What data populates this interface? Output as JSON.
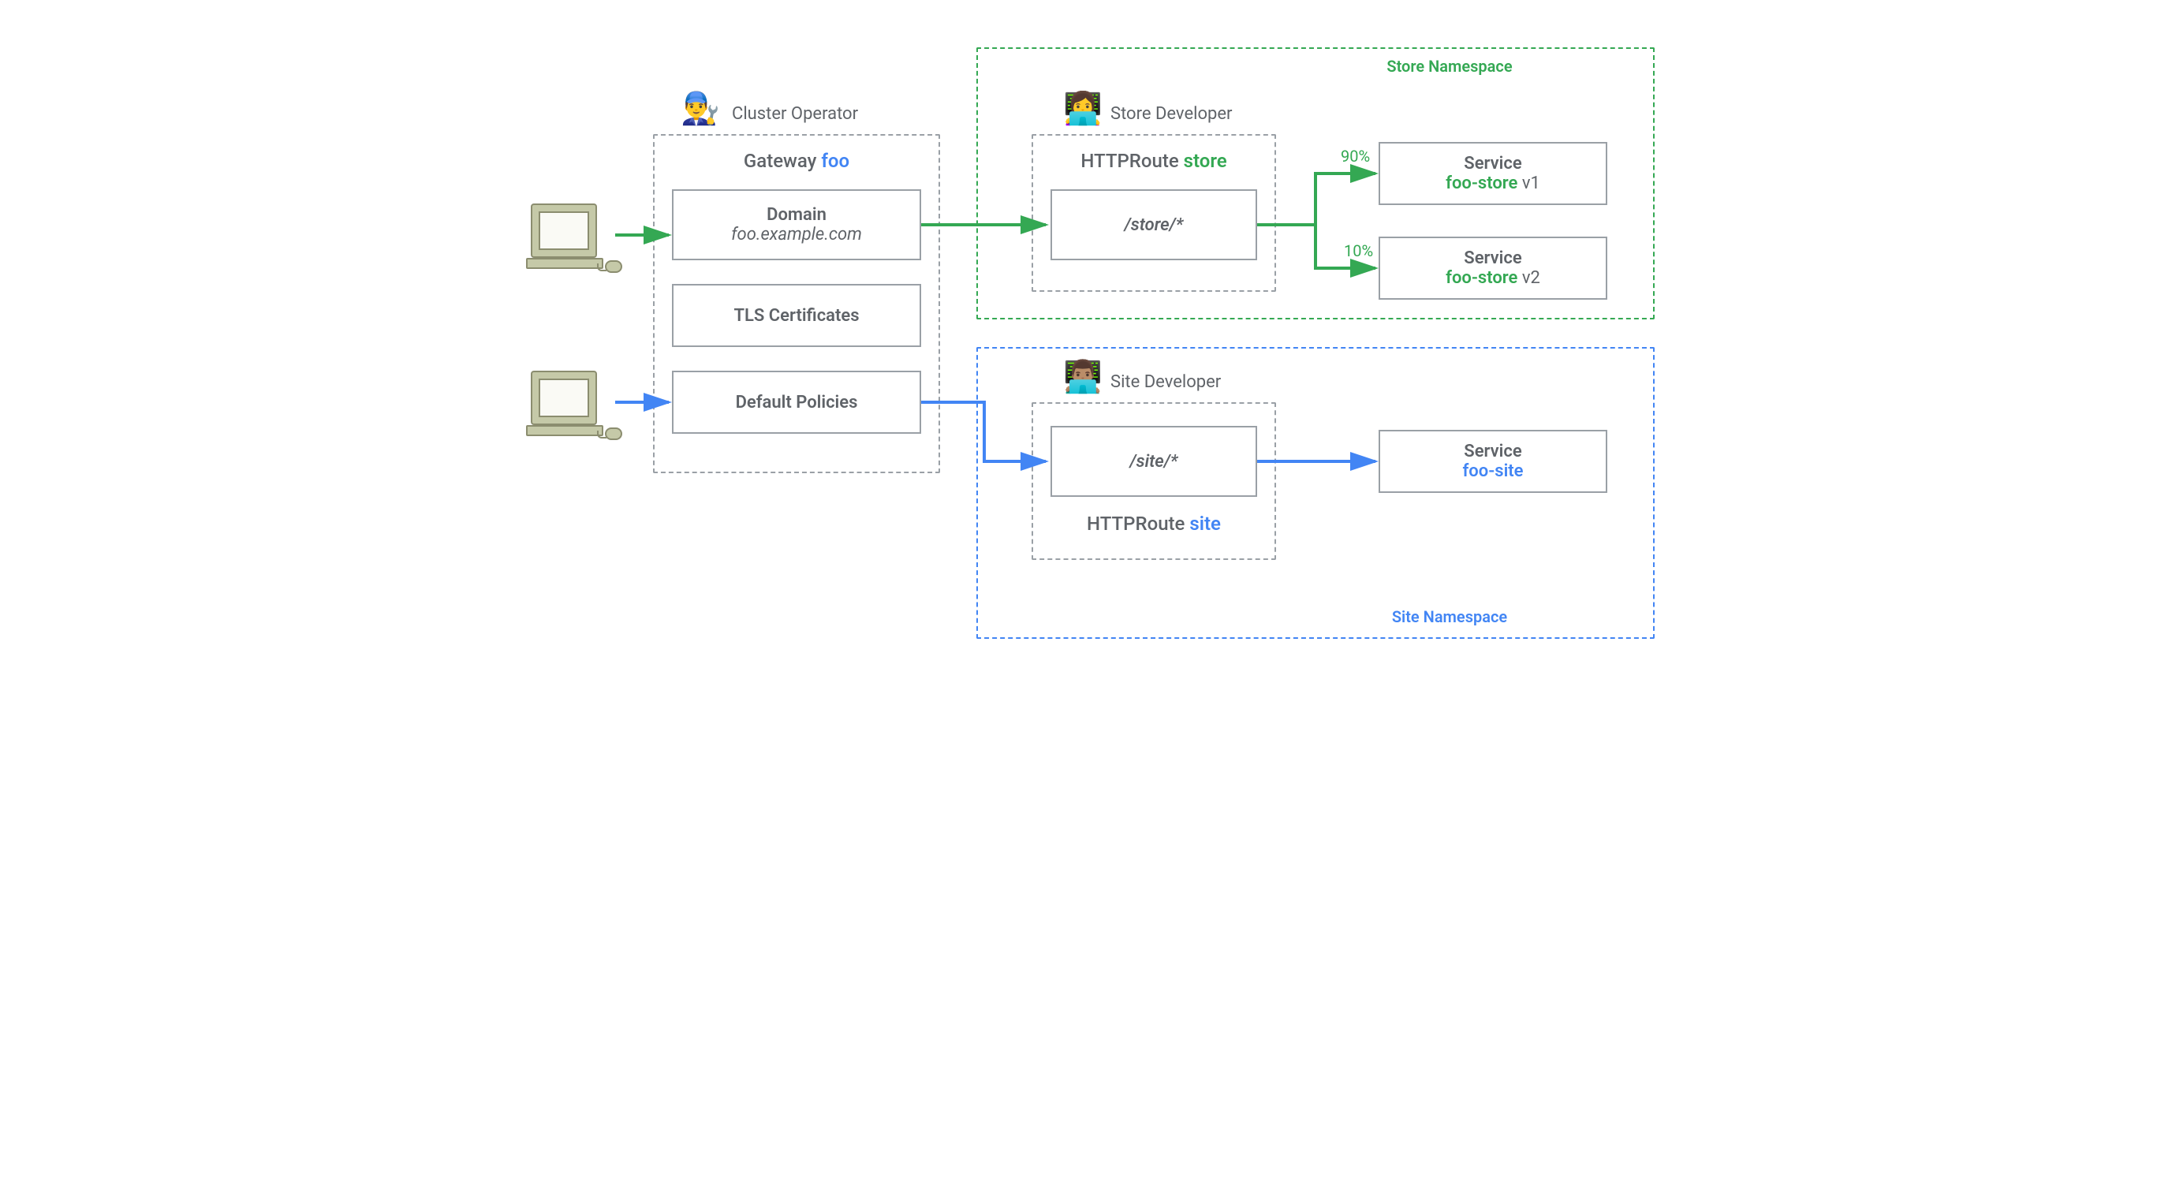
{
  "diagram": {
    "roles": {
      "cluster_operator": "Cluster Operator",
      "store_developer": "Store Developer",
      "site_developer": "Site Developer"
    },
    "gateway": {
      "title_prefix": "Gateway",
      "title_name": "foo",
      "domain_label": "Domain",
      "domain_value": "foo.example.com",
      "tls_label": "TLS Certificates",
      "policies_label": "Default Policies"
    },
    "store_ns": {
      "label": "Store Namespace",
      "route_prefix": "HTTPRoute",
      "route_name": "store",
      "path": "/store/*",
      "weight_a": "90%",
      "weight_b": "10%",
      "svc_a_label": "Service",
      "svc_a_name": "foo-store",
      "svc_a_ver": "v1",
      "svc_b_label": "Service",
      "svc_b_name": "foo-store",
      "svc_b_ver": "v2"
    },
    "site_ns": {
      "label": "Site Namespace",
      "route_prefix": "HTTPRoute",
      "route_name": "site",
      "path": "/site/*",
      "svc_label": "Service",
      "svc_name": "foo-site"
    }
  }
}
